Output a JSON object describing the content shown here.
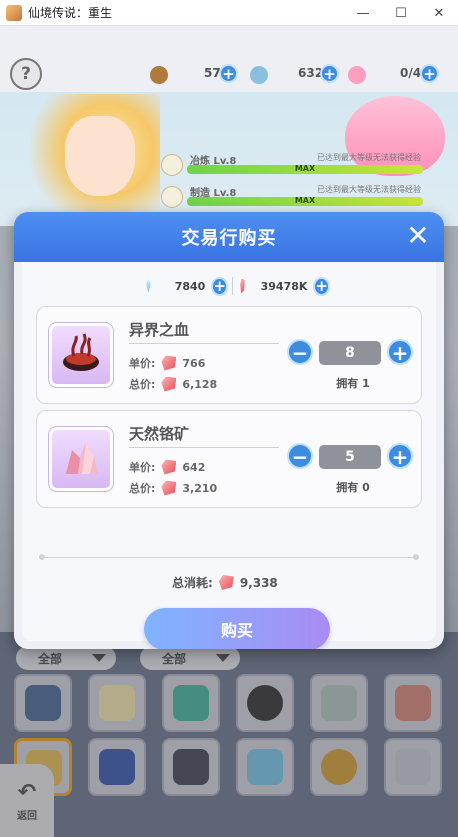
{
  "window": {
    "title": "仙境传说：重生",
    "minimize": "—",
    "maximize": "☐",
    "close": "✕"
  },
  "resources": {
    "res1": "57",
    "res2": "632",
    "res3": "0/4"
  },
  "skills": [
    {
      "label": "冶炼 Lv.8",
      "note": "已达到最大等级无法获得经验",
      "bar": "MAX"
    },
    {
      "label": "制造 Lv.8",
      "note": "已达到最大等级无法获得经验",
      "bar": "MAX"
    }
  ],
  "dialog": {
    "title": "交易行购买",
    "wallet": {
      "diamonds": "7840",
      "rubies": "39478K"
    },
    "items": [
      {
        "name": "异界之血",
        "price_label": "单价:",
        "price": "766",
        "total_label": "总价:",
        "total": "6,128",
        "qty": "8",
        "owned": "拥有 1"
      },
      {
        "name": "天然铬矿",
        "price_label": "单价:",
        "price": "642",
        "total_label": "总价:",
        "total": "3,210",
        "qty": "5",
        "owned": "拥有 0"
      }
    ],
    "total_label": "总消耗:",
    "total_value": "9,338",
    "buy_label": "购买"
  },
  "inventory": {
    "filter1": "全部",
    "filter2": "全部"
  },
  "back_label": "返回",
  "colors": {
    "accent": "#3d8ce0",
    "header": "#4d8ff2"
  }
}
